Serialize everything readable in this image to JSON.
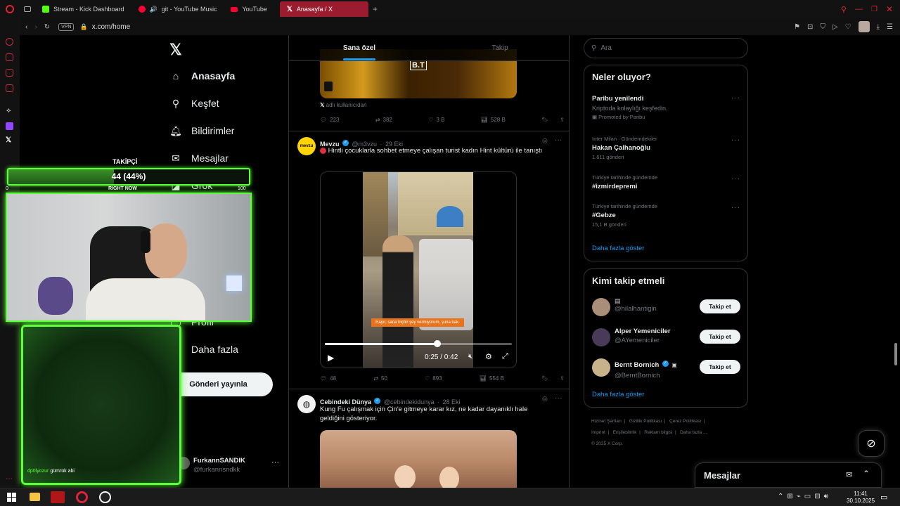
{
  "browser": {
    "tabs": [
      {
        "label": "Stream - Kick Dashboard",
        "color": "#53fc18"
      },
      {
        "label": "git - YouTube Music",
        "color": "#ff0033"
      },
      {
        "label": "YouTube",
        "color": "#ff0033"
      },
      {
        "label": "Anasayfa / X",
        "color": "#ffffff"
      }
    ],
    "url_scheme_badge": "VPN",
    "url": "x.com/home"
  },
  "nav": {
    "items": [
      {
        "label": "Anasayfa",
        "icon": "home-icon"
      },
      {
        "label": "Keşfet",
        "icon": "search-icon"
      },
      {
        "label": "Bildirimler",
        "icon": "bell-icon"
      },
      {
        "label": "Mesajlar",
        "icon": "mail-icon"
      },
      {
        "label": "Grok",
        "icon": "grok-icon"
      },
      {
        "label": "Profil",
        "icon": "user-icon"
      },
      {
        "label": "Daha fazla",
        "icon": "more-circle-icon"
      }
    ],
    "post_button": "Gönderi yayınla",
    "account": {
      "name": "FurkannSANDIK",
      "handle": "@furkannsndkk"
    }
  },
  "feed": {
    "tabs": [
      "Sana özel",
      "Takip"
    ],
    "tweet0": {
      "video_overlay_text": "B.T",
      "community_note": "adlı kullanıcıdan",
      "replies": "223",
      "retweets": "382",
      "likes": "3 B",
      "views": "528 B"
    },
    "tweet1": {
      "avatar_text": "mevzu",
      "name": "Mevzu",
      "handle": "@m3vzu",
      "date": "29 Eki",
      "text": "Hintli çocuklarla sohbet etmeye çalışan turist kadın Hint kültürü ile tanıştı",
      "subtitle": "Hayır, sana hiçbir şey vermiyorum, şuna bak.",
      "time": "0:25 / 0:42",
      "progress": 0.6,
      "replies": "48",
      "retweets": "50",
      "likes": "893",
      "views": "554 B"
    },
    "tweet2": {
      "name": "Cebindeki Dünya",
      "handle": "@cebindekidunya",
      "date": "28 Eki",
      "text": "Kung Fu çalışmak için Çin'e gitmeye karar kız, ne kadar dayanıklı hale geldiğini gösteriyor."
    }
  },
  "right": {
    "search_placeholder": "Ara",
    "trends_title": "Neler oluyor?",
    "trends": [
      {
        "context": "",
        "topic": "Paribu yenilendi",
        "desc": "Kriptoda kolaylığı keşfedin.",
        "meta": "Promoted by Paribu"
      },
      {
        "context": "Inter Milan · Gündemdekiler",
        "topic": "Hakan Çalhanoğlu",
        "meta": "1.611 gönderi"
      },
      {
        "context": "Türkiye tarihinde gündemde",
        "topic": "#izmirdepremi",
        "meta": ""
      },
      {
        "context": "Türkiye tarihinde gündemde",
        "topic": "#Gebze",
        "meta": "15,1 B gönderi"
      }
    ],
    "show_more": "Daha fazla göster",
    "who_title": "Kimi takip etmeli",
    "who": [
      {
        "name": "",
        "handle": "@hilalhantigin",
        "button": "Takip et"
      },
      {
        "name": "Alper Yemeniciler",
        "handle": "@AYemeniciler",
        "button": "Takip et"
      },
      {
        "name": "Bernt Bornich",
        "handle": "@BerntBornich",
        "button": "Takip et"
      }
    ],
    "footer_links": [
      "Hizmet Şartları",
      "Gizlilik Politikası",
      "Çerez Politikası",
      "Imprint",
      "Erişilebilirlik",
      "Reklam bilgisi",
      "Daha fazla ..."
    ],
    "copyright": "© 2025 X Corp.",
    "messages": "Mesajlar"
  },
  "overlay": {
    "followers_title": "TAKİPÇİ",
    "followers_value": "44 (44%)",
    "followers_progress": 0.44,
    "now_label": "RIGHT NOW",
    "range_min": "0",
    "range_max": "100",
    "chat_user": "dp0lyozur",
    "chat_message": "gümrük abi"
  },
  "taskbar": {
    "time": "11:41",
    "date": "30.10.2025"
  },
  "colors": {
    "accent": "#1d9bf0",
    "overlay_green": "#5dff3a",
    "tab_active": "#9b1c2e"
  }
}
